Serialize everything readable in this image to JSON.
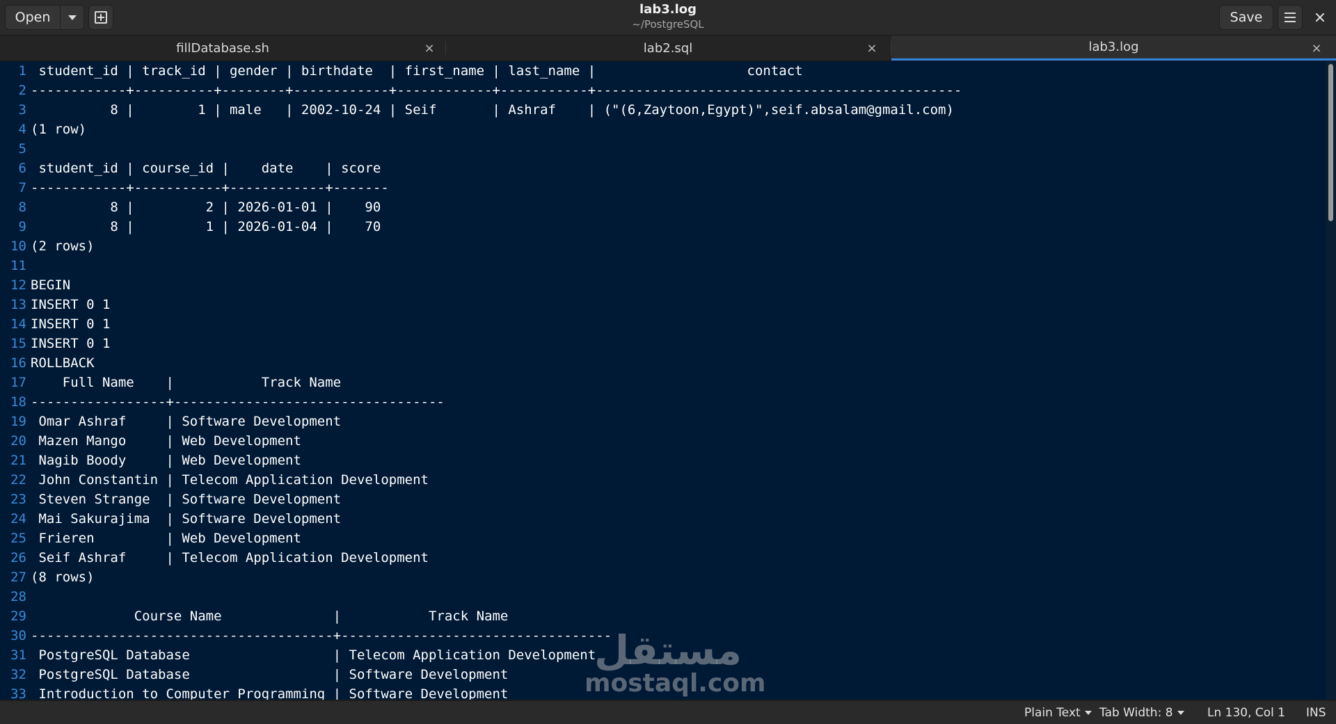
{
  "header": {
    "open_label": "Open",
    "save_label": "Save",
    "title": "lab3.log",
    "subtitle": "~/PostgreSQL"
  },
  "tabs": [
    {
      "label": "fillDatabase.sh",
      "active": false
    },
    {
      "label": "lab2.sql",
      "active": false
    },
    {
      "label": "lab3.log",
      "active": true
    }
  ],
  "editor": {
    "lines": [
      " student_id | track_id | gender | birthdate  | first_name | last_name |                   contact",
      "------------+----------+--------+------------+------------+-----------+----------------------------------------------",
      "          8 |        1 | male   | 2002-10-24 | Seif       | Ashraf    | (\"(6,Zaytoon,Egypt)\",seif.absalam@gmail.com)",
      "(1 row)",
      "",
      " student_id | course_id |    date    | score",
      "------------+-----------+------------+-------",
      "          8 |         2 | 2026-01-01 |    90",
      "          8 |         1 | 2026-01-04 |    70",
      "(2 rows)",
      "",
      "BEGIN",
      "INSERT 0 1",
      "INSERT 0 1",
      "INSERT 0 1",
      "ROLLBACK",
      "    Full Name    |           Track Name",
      "-----------------+----------------------------------",
      " Omar Ashraf     | Software Development",
      " Mazen Mango     | Web Development",
      " Nagib Boody     | Web Development",
      " John Constantin | Telecom Application Development",
      " Steven Strange  | Software Development",
      " Mai Sakurajima  | Software Development",
      " Frieren         | Web Development",
      " Seif Ashraf     | Telecom Application Development",
      "(8 rows)",
      "",
      "             Course Name              |           Track Name",
      "--------------------------------------+----------------------------------",
      " PostgreSQL Database                  | Telecom Application Development",
      " PostgreSQL Database                  | Software Development",
      " Introduction to Computer Programming | Software Development"
    ]
  },
  "watermark": {
    "arabic": "مستقل",
    "latin": "mostaql.com"
  },
  "statusbar": {
    "language": "Plain Text",
    "tab_width": "Tab Width: 8",
    "position": "Ln 130, Col 1",
    "mode": "INS"
  },
  "colors": {
    "editor_bg": "#001935",
    "line_number": "#3b8bd9",
    "text": "#ffffff",
    "accent": "#3584e4"
  }
}
